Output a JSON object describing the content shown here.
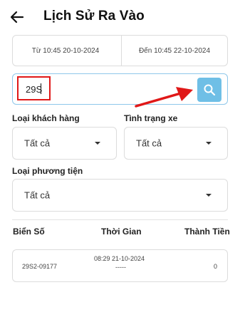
{
  "header": {
    "title": "Lịch Sử Ra Vào",
    "back_icon": "arrow-left-icon"
  },
  "date_range": {
    "from": "Từ 10:45 20-10-2024",
    "to": "Đến 10:45 22-10-2024"
  },
  "search": {
    "value": "29S",
    "icon": "search-icon",
    "button_color": "#6fbfe6"
  },
  "filters": {
    "customer_type": {
      "label": "Loại khách hàng",
      "value": "Tất cả"
    },
    "vehicle_status": {
      "label": "Tình trạng xe",
      "value": "Tất cả"
    },
    "vehicle_type": {
      "label": "Loại phương tiện",
      "value": "Tất cả"
    }
  },
  "table": {
    "columns": [
      "Biển Số",
      "Thời Gian",
      "Thành Tiền"
    ],
    "rows": [
      {
        "plate": "29S2-09177",
        "time_in": "08:29 21-10-2024",
        "time_out": "-----",
        "amount": "0"
      }
    ]
  },
  "colors": {
    "annotation_red": "#e01818",
    "accent_blue": "#6fbfe6"
  }
}
